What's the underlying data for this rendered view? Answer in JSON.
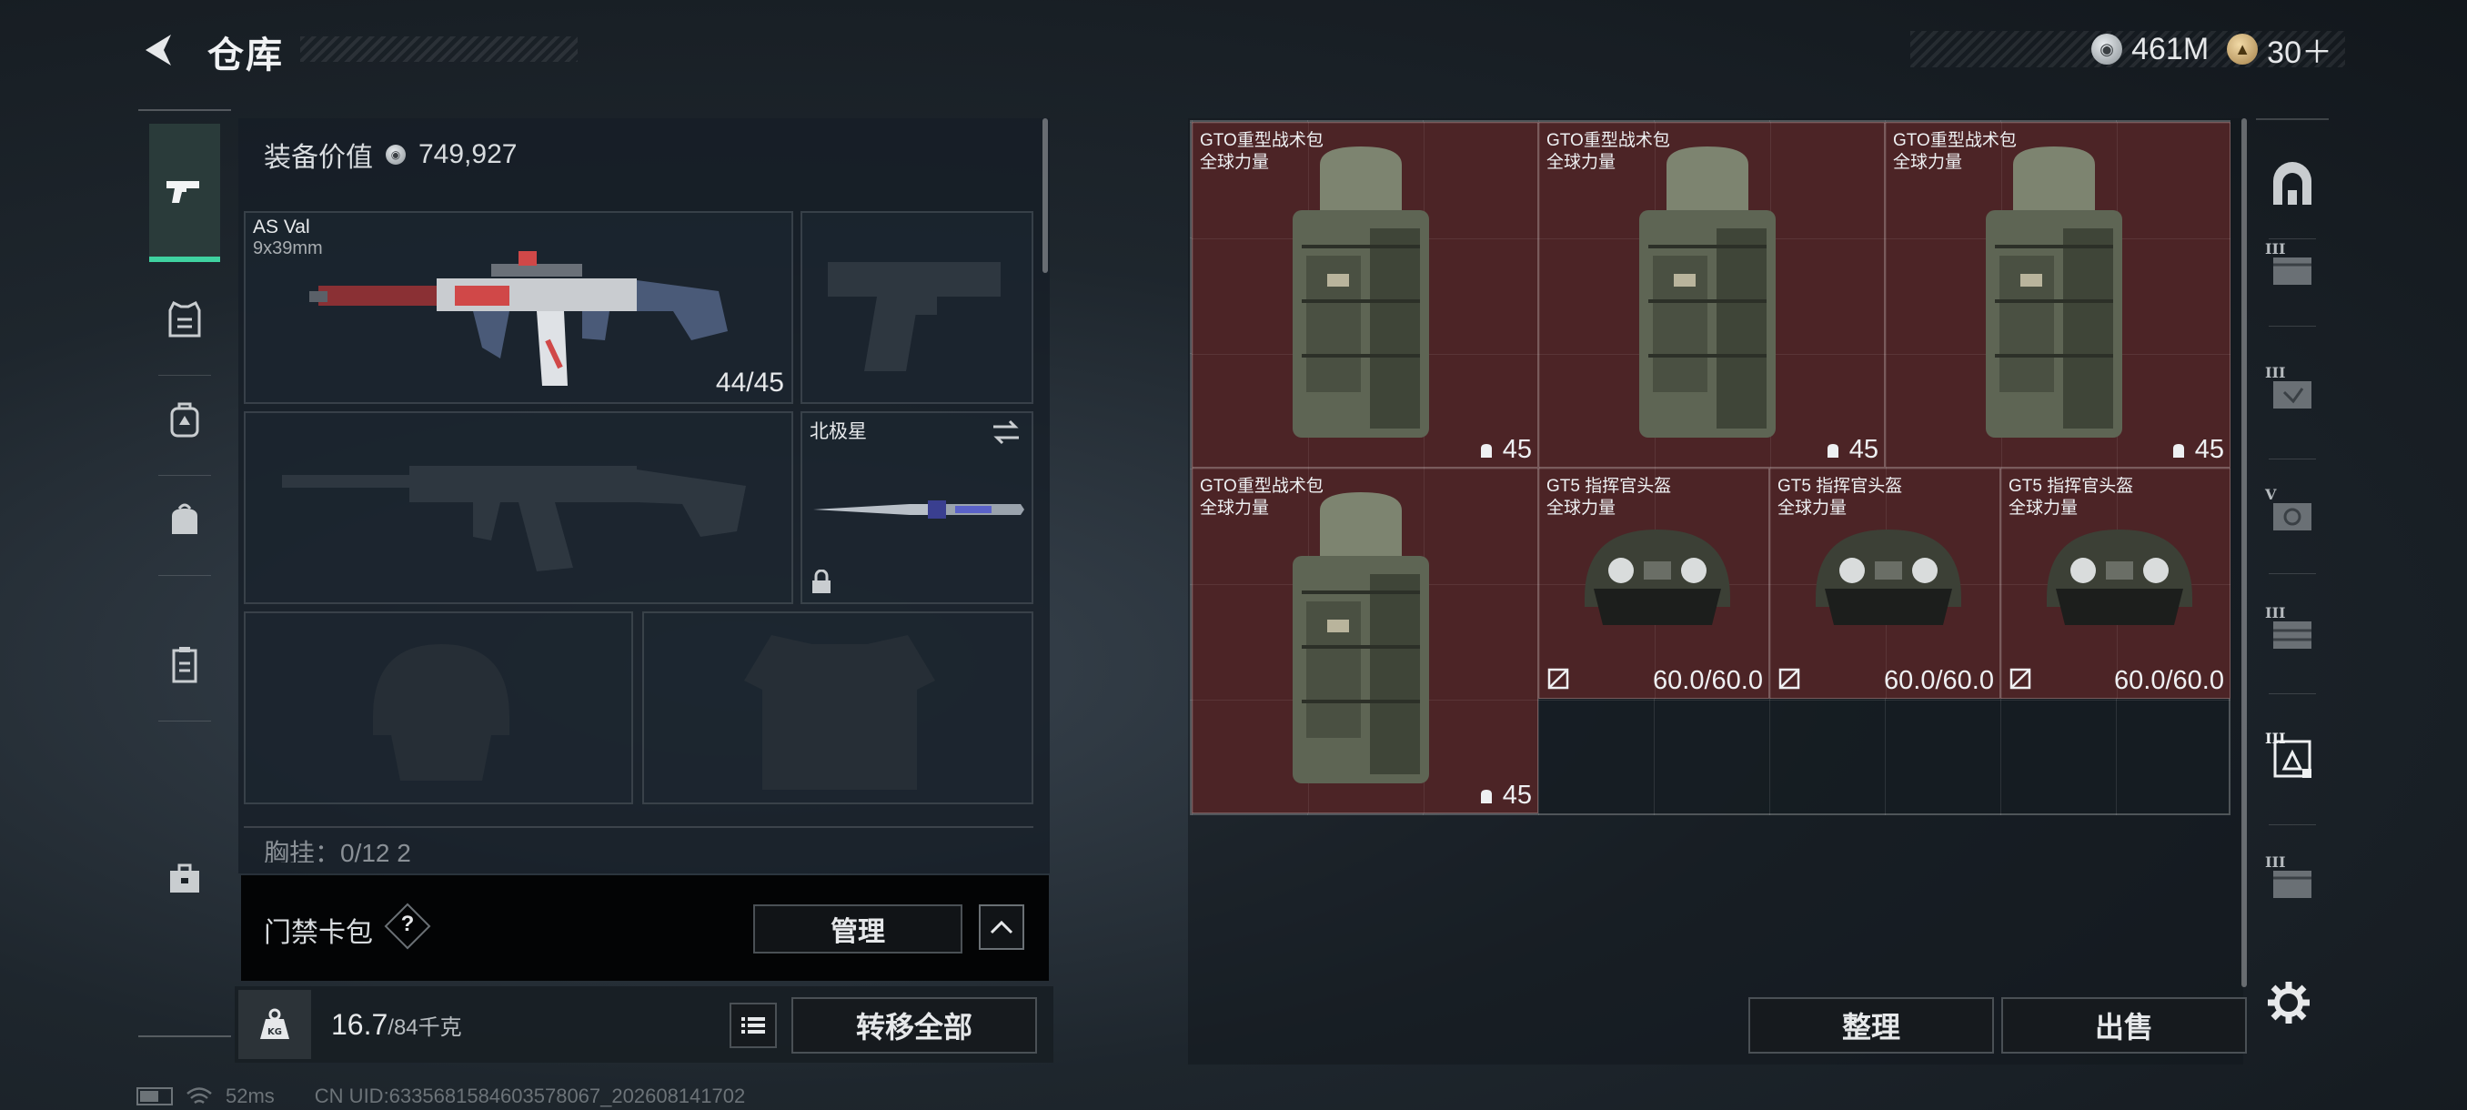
{
  "header": {
    "title": "仓库",
    "currencies": [
      {
        "icon": "silver-coin-icon",
        "value": "461M"
      },
      {
        "icon": "gold-coin-icon",
        "value": "30＋"
      }
    ]
  },
  "left_nav": {
    "items": [
      "pistol-icon",
      "vest-icon",
      "backpack-icon",
      "pouch-icon",
      "clipboard-icon",
      "toolbox-icon"
    ],
    "active": 0
  },
  "equipment": {
    "value_label": "装备价值",
    "value": "749,927",
    "primary_weapon": {
      "name": "AS Val",
      "caliber": "9x39mm",
      "ammo": "44/45"
    },
    "knife": {
      "name": "北极星"
    },
    "chest_rig_label": "胸挂：0/12 2"
  },
  "keycard": {
    "label": "门禁卡包",
    "help": "?",
    "manage": "管理"
  },
  "weight": {
    "current": "16.7",
    "max": "/84千克"
  },
  "transfer_all": "转移全部",
  "status": {
    "ping": "52ms",
    "uid": "CN UID:6335681584603578067_202608141702"
  },
  "storage": {
    "items": [
      {
        "name": "GTO重型战术包",
        "sub": "全球力量",
        "stat": "45",
        "kind": "backpack"
      },
      {
        "name": "GTO重型战术包",
        "sub": "全球力量",
        "stat": "45",
        "kind": "backpack"
      },
      {
        "name": "GTO重型战术包",
        "sub": "全球力量",
        "stat": "45",
        "kind": "backpack"
      },
      {
        "name": "GTO重型战术包",
        "sub": "全球力量",
        "stat": "45",
        "kind": "backpack"
      },
      {
        "name": "GT5 指挥官头盔",
        "sub": "全球力量",
        "stat": "60.0/60.0",
        "kind": "helmet"
      },
      {
        "name": "GT5 指挥官头盔",
        "sub": "全球力量",
        "stat": "60.0/60.0",
        "kind": "helmet"
      },
      {
        "name": "GT5 指挥官头盔",
        "sub": "全球力量",
        "stat": "60.0/60.0",
        "kind": "helmet"
      }
    ],
    "tidy": "整理",
    "sell": "出售"
  },
  "right_nav": {
    "tiers": [
      "",
      "III",
      "III",
      "V",
      "III",
      "III",
      "III"
    ]
  },
  "colors": {
    "accent": "#3fd2a0",
    "item_bg": "#4c2426"
  }
}
